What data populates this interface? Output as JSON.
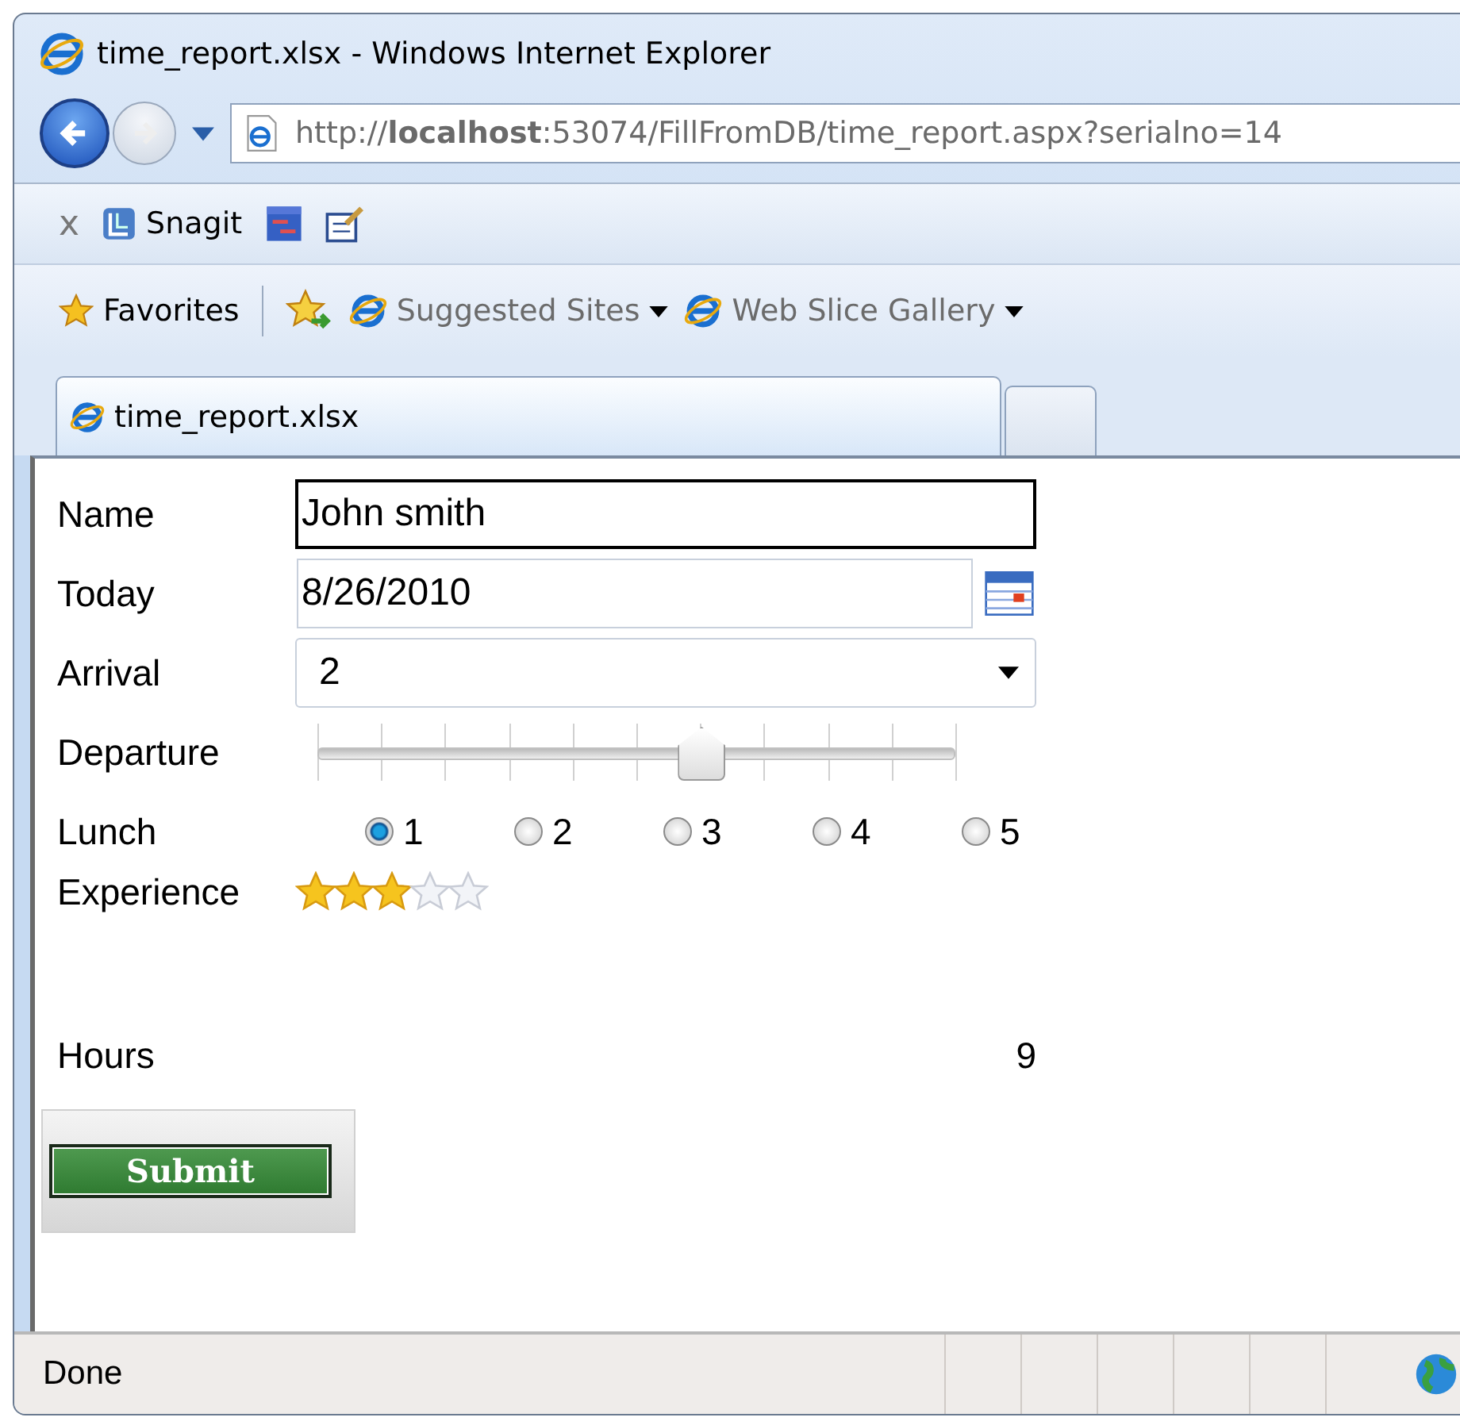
{
  "window": {
    "title": "time_report.xlsx - Windows Internet Explorer"
  },
  "address_bar": {
    "url": "http://**localhost**:53074/FillFromDB/time_report.aspx?serialno=14"
  },
  "command_bar": {
    "close_label": "x",
    "items": [
      {
        "kind": "snagit",
        "label": "Snagit"
      },
      {
        "kind": "window"
      },
      {
        "kind": "edit"
      }
    ]
  },
  "favorites_bar": {
    "favorites": "Favorites",
    "links": [
      {
        "label": "Suggested Sites"
      },
      {
        "label": "Web Slice Gallery"
      }
    ]
  },
  "tabs": [
    {
      "label": "time_report.xlsx",
      "selected": true
    },
    {
      "selected": false
    }
  ],
  "form": {
    "name": {
      "label": "Name",
      "value": "John smith"
    },
    "today": {
      "label": "Today",
      "value": "8/26/2010"
    },
    "arrival": {
      "label": "Arrival",
      "value": "2"
    },
    "departure": {
      "label": "Departure",
      "level": 0.6
    },
    "lunch": {
      "label": "Lunch",
      "options": [
        {
          "label": "1",
          "selected": true
        },
        {
          "label": "2",
          "selected": false
        },
        {
          "label": "3",
          "selected": false
        },
        {
          "label": "4",
          "selected": false
        },
        {
          "label": "5",
          "selected": false
        }
      ]
    },
    "experience": {
      "label": "Experience",
      "stars": 3
    },
    "hours": {
      "label": "Hours",
      "value": "9"
    },
    "submit": "Submit"
  },
  "status_bar": {
    "text": "Done"
  }
}
